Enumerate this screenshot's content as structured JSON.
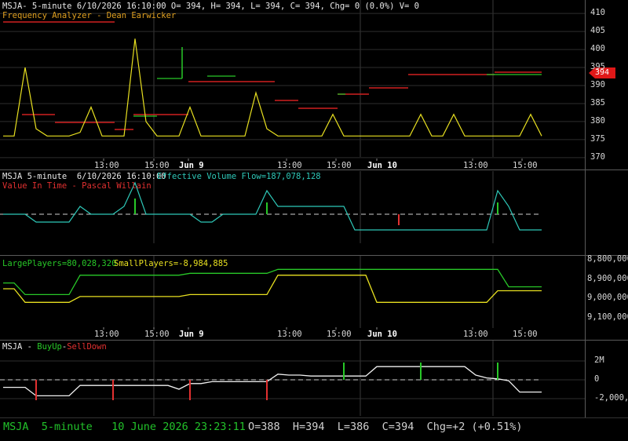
{
  "panel1": {
    "header": "MSJA- 5-minute 6/10/2026 16:10:00 O= 394, H= 394, L= 394, C= 394, Chg= 0 (0.0%) V= 0",
    "indicator": "Frequency Analyzer - Dean Earwicker",
    "price_tag": "394",
    "y_ticks": [
      "410",
      "405",
      "400",
      "395",
      "390",
      "385",
      "380",
      "375",
      "370"
    ]
  },
  "time_axis": {
    "labels": [
      "13:00",
      "15:00",
      "Jun 9",
      "13:00",
      "15:00",
      "Jun 10",
      "13:00",
      "15:00"
    ]
  },
  "panel2": {
    "header_prefix": "MSJA 5-minute  6/10/2026 16:10:00",
    "header_evf": "Effective Volume Flow=187,078,128",
    "indicator": "Value In Time - Pascal Willain"
  },
  "panel3": {
    "large_label": "LargePlayers=80,028,320",
    "small_label": "SmallPlayers=-8,984,885",
    "y_ticks": [
      "8,800,000",
      "8,900,000",
      "9,000,000",
      "9,100,000"
    ]
  },
  "panel4": {
    "prefix": "MSJA - ",
    "buy_label": "BuyUp",
    "sep": "-",
    "sell_label": "SellDown",
    "y_ticks": [
      "2M",
      "0",
      "-2,000,000"
    ]
  },
  "status": {
    "left": "MSJA  5-minute   10 June 2026 23:23:11",
    "right": "O=388  H=394  L=386  C=394  Chg=+2 (+0.51%)"
  },
  "chart_data": [
    {
      "type": "line",
      "title": "MSJA- 5-minute",
      "series": [
        {
          "name": "Frequency Analyzer",
          "values": [
            376,
            376,
            395,
            378,
            376,
            376,
            376,
            377,
            384,
            376,
            376,
            376,
            403,
            380,
            376,
            376,
            376,
            384,
            376,
            376,
            376,
            376,
            376,
            388,
            378,
            376,
            376,
            376,
            376,
            376,
            382,
            376,
            376,
            376,
            376,
            376,
            376,
            376,
            382,
            376,
            376,
            382,
            376,
            376,
            376,
            376,
            376,
            376,
            382,
            376
          ]
        }
      ],
      "ylim": [
        368,
        412
      ]
    },
    {
      "type": "line",
      "title": "Effective Volume Flow=187,078,128",
      "series": [
        {
          "name": "Value In Time",
          "values": [
            0,
            0,
            0,
            -1,
            -1,
            -1,
            -1,
            1,
            0,
            0,
            0,
            1,
            4,
            0,
            0,
            0,
            0,
            0,
            -1,
            -1,
            0,
            0,
            0,
            0,
            3,
            1,
            1,
            1,
            1,
            1,
            1,
            1,
            -2,
            -2,
            -2,
            -2,
            -2,
            -2,
            -2,
            -2,
            -2,
            -2,
            -2,
            -2,
            -2,
            3,
            1,
            -2,
            -2,
            -2
          ]
        }
      ]
    },
    {
      "type": "line",
      "title": "LargePlayers / SmallPlayers",
      "series": [
        {
          "name": "LargePlayers",
          "values": [
            8920000,
            8920000,
            8980000,
            8980000,
            8980000,
            8980000,
            8980000,
            8880000,
            8880000,
            8880000,
            8880000,
            8880000,
            8880000,
            8880000,
            8880000,
            8880000,
            8880000,
            8870000,
            8870000,
            8870000,
            8870000,
            8870000,
            8870000,
            8870000,
            8870000,
            8850000,
            8850000,
            8850000,
            8850000,
            8850000,
            8850000,
            8850000,
            8850000,
            8850000,
            8850000,
            8850000,
            8850000,
            8850000,
            8850000,
            8850000,
            8850000,
            8850000,
            8850000,
            8850000,
            8850000,
            8850000,
            8940000,
            8940000,
            8940000,
            8940000
          ]
        },
        {
          "name": "SmallPlayers",
          "values": [
            8950000,
            8950000,
            9020000,
            9020000,
            9020000,
            9020000,
            9020000,
            8990000,
            8990000,
            8990000,
            8990000,
            8990000,
            8990000,
            8990000,
            8990000,
            8990000,
            8990000,
            8980000,
            8980000,
            8980000,
            8980000,
            8980000,
            8980000,
            8980000,
            8980000,
            8880000,
            8880000,
            8880000,
            8880000,
            8880000,
            8880000,
            8880000,
            8880000,
            8880000,
            9020000,
            9020000,
            9020000,
            9020000,
            9020000,
            9020000,
            9020000,
            9020000,
            9020000,
            9020000,
            9020000,
            8960000,
            8960000,
            8960000,
            8960000,
            8960000
          ]
        }
      ]
    },
    {
      "type": "line",
      "title": "MSJA - BuyUp-SellDown",
      "series": [
        {
          "name": "BuyUp-SellDown",
          "values": [
            -0.8,
            -0.8,
            -0.8,
            -1.7,
            -1.7,
            -1.7,
            -1.7,
            -0.6,
            -0.6,
            -0.6,
            -0.6,
            -0.6,
            -0.6,
            -0.6,
            -0.6,
            -0.6,
            -1.0,
            -0.4,
            -0.4,
            -0.2,
            -0.2,
            -0.2,
            -0.2,
            -0.2,
            -0.2,
            0.6,
            0.5,
            0.5,
            0.4,
            0.4,
            0.4,
            0.4,
            0.4,
            0.4,
            1.4,
            1.4,
            1.4,
            1.4,
            1.4,
            1.4,
            1.4,
            1.4,
            1.4,
            0.5,
            0.2,
            0.1,
            -0.1,
            -1.3,
            -1.3,
            -1.3
          ]
        }
      ],
      "ylim": [
        -3000000,
        3000000
      ]
    }
  ]
}
